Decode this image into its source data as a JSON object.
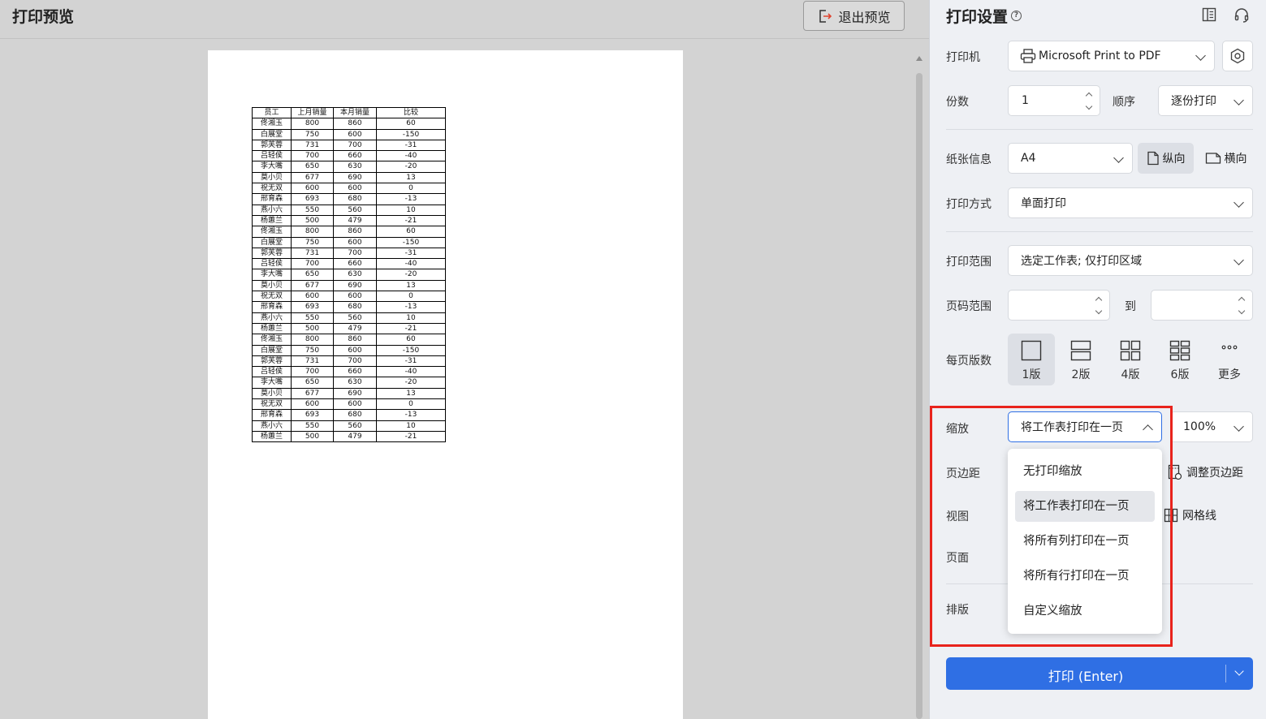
{
  "preview": {
    "title": "打印预览",
    "exit_label": "退出预览",
    "table": {
      "headers": [
        "员工",
        "上月销量",
        "本月销量",
        "比较"
      ],
      "rows": [
        [
          "佟湘玉",
          "800",
          "860",
          "60"
        ],
        [
          "白展堂",
          "750",
          "600",
          "-150"
        ],
        [
          "郭芙蓉",
          "731",
          "700",
          "-31"
        ],
        [
          "吕轻侯",
          "700",
          "660",
          "-40"
        ],
        [
          "李大嘴",
          "650",
          "630",
          "-20"
        ],
        [
          "莫小贝",
          "677",
          "690",
          "13"
        ],
        [
          "祝无双",
          "600",
          "600",
          "0"
        ],
        [
          "邢育森",
          "693",
          "680",
          "-13"
        ],
        [
          "燕小六",
          "550",
          "560",
          "10"
        ],
        [
          "杨蕙兰",
          "500",
          "479",
          "-21"
        ],
        [
          "佟湘玉",
          "800",
          "860",
          "60"
        ],
        [
          "白展堂",
          "750",
          "600",
          "-150"
        ],
        [
          "郭芙蓉",
          "731",
          "700",
          "-31"
        ],
        [
          "吕轻侯",
          "700",
          "660",
          "-40"
        ],
        [
          "李大嘴",
          "650",
          "630",
          "-20"
        ],
        [
          "莫小贝",
          "677",
          "690",
          "13"
        ],
        [
          "祝无双",
          "600",
          "600",
          "0"
        ],
        [
          "邢育森",
          "693",
          "680",
          "-13"
        ],
        [
          "燕小六",
          "550",
          "560",
          "10"
        ],
        [
          "杨蕙兰",
          "500",
          "479",
          "-21"
        ],
        [
          "佟湘玉",
          "800",
          "860",
          "60"
        ],
        [
          "白展堂",
          "750",
          "600",
          "-150"
        ],
        [
          "郭芙蓉",
          "731",
          "700",
          "-31"
        ],
        [
          "吕轻侯",
          "700",
          "660",
          "-40"
        ],
        [
          "李大嘴",
          "650",
          "630",
          "-20"
        ],
        [
          "莫小贝",
          "677",
          "690",
          "13"
        ],
        [
          "祝无双",
          "600",
          "600",
          "0"
        ],
        [
          "邢育森",
          "693",
          "680",
          "-13"
        ],
        [
          "燕小六",
          "550",
          "560",
          "10"
        ],
        [
          "杨蕙兰",
          "500",
          "479",
          "-21"
        ]
      ]
    }
  },
  "settings": {
    "title": "打印设置",
    "help_glyph": "?",
    "printer_label": "打印机",
    "printer_value": "Microsoft Print to PDF",
    "copies_label": "份数",
    "copies_value": "1",
    "order_label": "顺序",
    "order_value": "逐份打印",
    "paper_label": "纸张信息",
    "paper_value": "A4",
    "portrait_label": "纵向",
    "landscape_label": "横向",
    "mode_label": "打印方式",
    "mode_value": "单面打印",
    "range_label": "打印范围",
    "range_value": "选定工作表; 仅打印区域",
    "page_range_label": "页码范围",
    "page_range_to": "到",
    "page_range_from_value": "",
    "page_range_to_value": "",
    "pages_per_sheet_label": "每页版数",
    "pages_per_sheet_options": [
      "1版",
      "2版",
      "4版",
      "6版",
      "更多"
    ],
    "scale_label": "缩放",
    "scale_value": "将工作表打印在一页",
    "scale_percent": "100%",
    "margin_label": "页边距",
    "adjust_margin_label": "调整页边距",
    "view_label": "视图",
    "gridlines_label": "网格线",
    "page_label": "页面",
    "layout_label": "排版",
    "print_button": "打印 (Enter)",
    "scale_menu": [
      "无打印缩放",
      "将工作表打印在一页",
      "将所有列打印在一页",
      "将所有行打印在一页",
      "自定义缩放"
    ]
  },
  "colors": {
    "accent": "#2f6fe4",
    "highlight": "#e8231c"
  }
}
